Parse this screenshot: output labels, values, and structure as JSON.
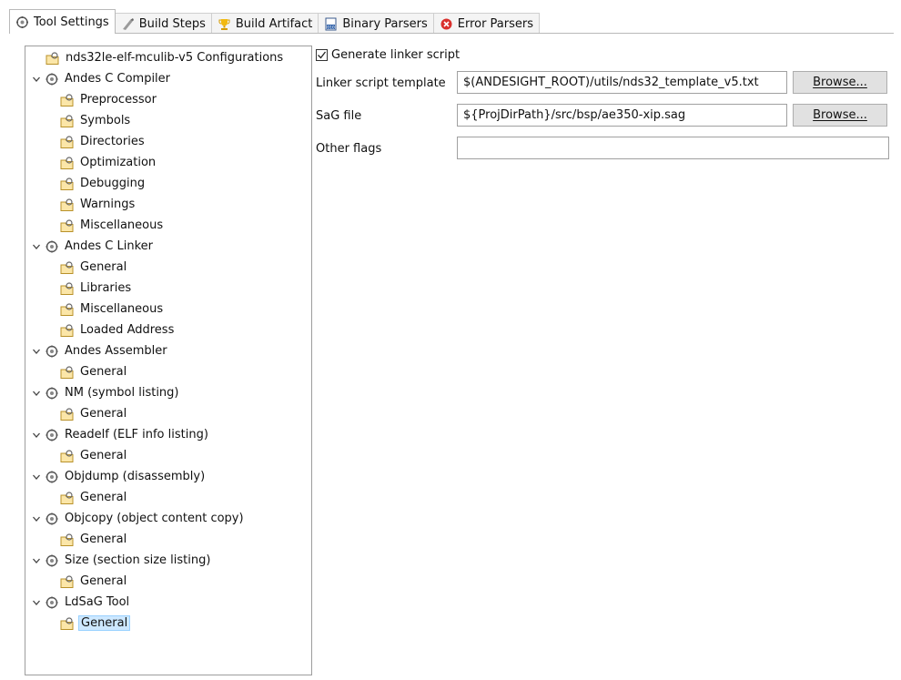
{
  "tabs": [
    {
      "label": "Tool Settings",
      "icon": "tool-settings-gear-icon",
      "active": true
    },
    {
      "label": "Build Steps",
      "icon": "build-steps-icon"
    },
    {
      "label": "Build Artifact",
      "icon": "trophy-icon"
    },
    {
      "label": "Binary Parsers",
      "icon": "binary-icon"
    },
    {
      "label": "Error Parsers",
      "icon": "error-icon"
    }
  ],
  "tree": {
    "root": "nds32le-elf-mculib-v5 Configurations",
    "groups": [
      {
        "label": "Andes C Compiler",
        "children": [
          "Preprocessor",
          "Symbols",
          "Directories",
          "Optimization",
          "Debugging",
          "Warnings",
          "Miscellaneous"
        ]
      },
      {
        "label": "Andes C Linker",
        "children": [
          "General",
          "Libraries",
          "Miscellaneous",
          "Loaded Address"
        ]
      },
      {
        "label": "Andes Assembler",
        "children": [
          "General"
        ]
      },
      {
        "label": "NM (symbol listing)",
        "children": [
          "General"
        ]
      },
      {
        "label": "Readelf (ELF info listing)",
        "children": [
          "General"
        ]
      },
      {
        "label": "Objdump (disassembly)",
        "children": [
          "General"
        ]
      },
      {
        "label": "Objcopy (object content copy)",
        "children": [
          "General"
        ]
      },
      {
        "label": "Size (section size listing)",
        "children": [
          "General"
        ]
      },
      {
        "label": "LdSaG Tool",
        "children": [
          "General"
        ]
      }
    ],
    "selected": "LdSaG Tool / General"
  },
  "form": {
    "generate_linker_script": {
      "label": "Generate linker script",
      "checked": true
    },
    "linker_template": {
      "label": "Linker script template",
      "value": "$(ANDESIGHT_ROOT)/utils/nds32_template_v5.txt",
      "button": "Browse..."
    },
    "sag_file": {
      "label": "SaG file",
      "value": "${ProjDirPath}/src/bsp/ae350-xip.sag",
      "button": "Browse..."
    },
    "other_flags": {
      "label": "Other flags",
      "value": ""
    }
  },
  "colors": {
    "selection": "#cde8ff",
    "selection_border": "#99d1ff",
    "button_bg": "#e1e1e1"
  }
}
